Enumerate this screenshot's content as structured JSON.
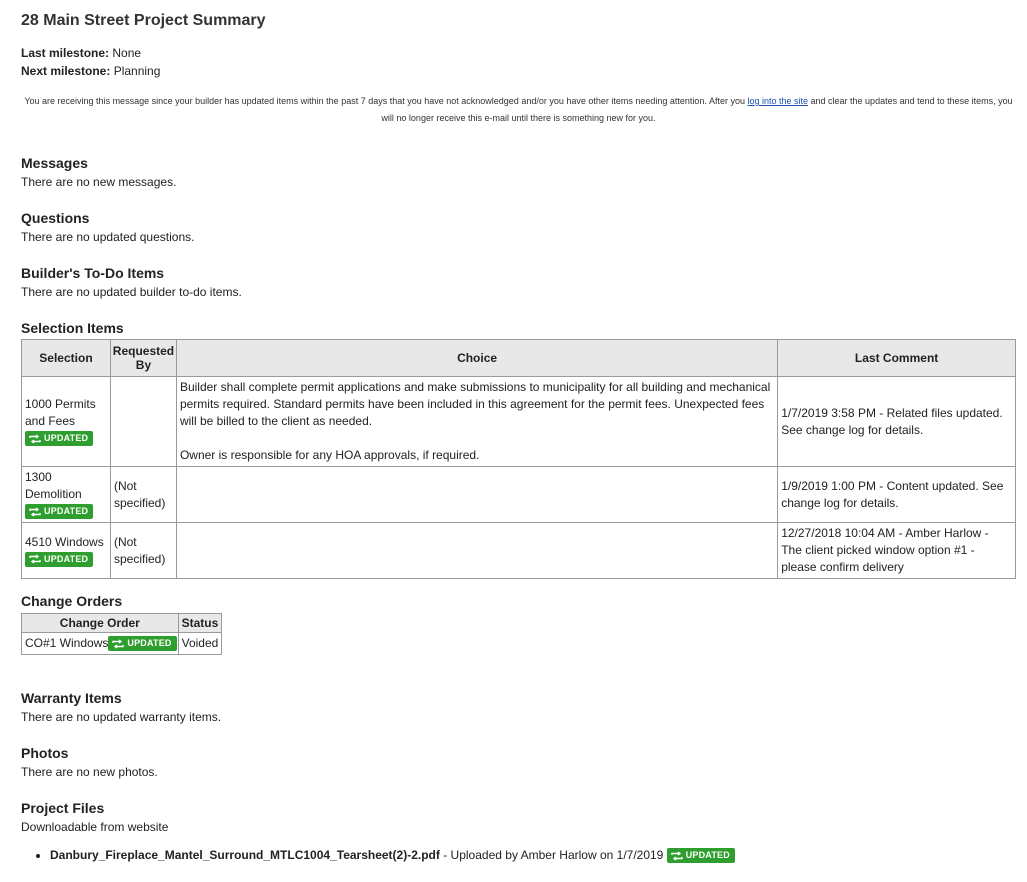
{
  "title": "28 Main Street Project Summary",
  "milestones": {
    "last_label": "Last milestone:",
    "last_value": "None",
    "next_label": "Next milestone:",
    "next_value": "Planning"
  },
  "notice": {
    "before": "You are receiving this message since your builder has updated items within the past 7 days that you have not acknowledged and/or you have other items needing attention. After you ",
    "link": "log into the site",
    "after": " and clear the updates and tend to these items, you will no longer receive this e-mail until there is something new for you."
  },
  "badge_text": "UPDATED",
  "messages": {
    "title": "Messages",
    "text": "There are no new messages."
  },
  "questions": {
    "title": "Questions",
    "text": "There are no updated questions."
  },
  "todos": {
    "title": "Builder's To-Do Items",
    "text": "There are no updated builder to-do items."
  },
  "selections": {
    "title": "Selection Items",
    "headers": [
      "Selection",
      "Requested By",
      "Choice",
      "Last Comment"
    ],
    "rows": [
      {
        "selection": "1000 Permits and Fees",
        "requested_by": "",
        "choice_p1": "Builder shall complete permit applications and make submissions to municipality for all building and mechanical permits required. Standard permits have been included in this agreement for the permit fees. Unexpected fees will be billed to the client as needed.",
        "choice_p2": "Owner is responsible for any HOA approvals, if required.",
        "comment": "1/7/2019 3:58 PM - Related files updated. See change log for details."
      },
      {
        "selection": "1300 Demolition",
        "requested_by": "(Not specified)",
        "choice_p1": "",
        "choice_p2": "",
        "comment": "1/9/2019 1:00 PM - Content updated. See change log for details."
      },
      {
        "selection": "4510 Windows",
        "requested_by": "(Not specified)",
        "choice_p1": "",
        "choice_p2": "",
        "comment": "12/27/2018 10:04 AM - Amber Harlow - The client picked window option #1 - please confirm delivery"
      }
    ]
  },
  "change_orders": {
    "title": "Change Orders",
    "headers": [
      "Change Order",
      "Status"
    ],
    "rows": [
      {
        "name": "CO#1 Windows",
        "status": "Voided"
      }
    ]
  },
  "warranty": {
    "title": "Warranty Items",
    "text": "There are no updated warranty items."
  },
  "photos": {
    "title": "Photos",
    "text": "There are no new photos."
  },
  "files": {
    "title": "Project Files",
    "subtitle": "Downloadable from website",
    "items": [
      {
        "name": "Danbury_Fireplace_Mantel_Surround_MTLC1004_Tearsheet(2)-2.pdf",
        "meta": " - Uploaded by Amber Harlow on 1/7/2019 "
      }
    ]
  }
}
